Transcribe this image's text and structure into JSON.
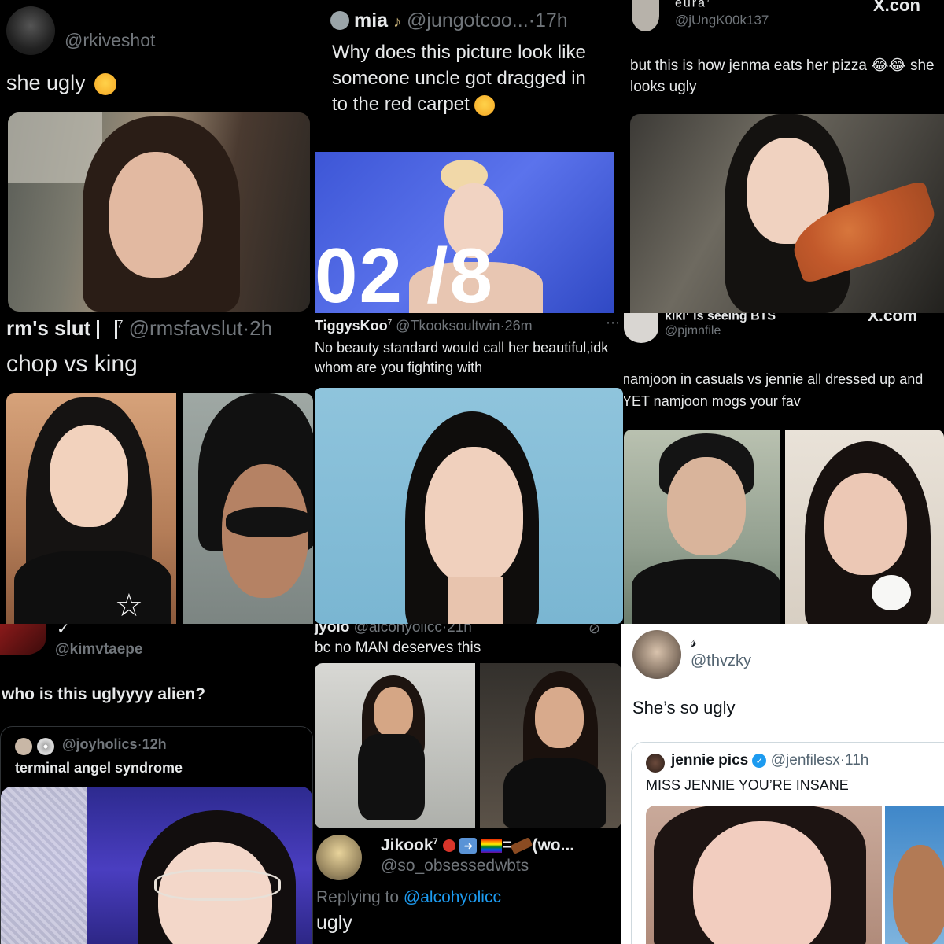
{
  "tiles": [
    {
      "handle": "@rkiveshot",
      "text": "she ugly",
      "emoji": "crying-face"
    },
    {
      "name": "mia",
      "music_note": "♪",
      "handle": "@jungotcoo...",
      "dot": "·",
      "time": "17h",
      "text": "Why does this picture look like someone uncle got dragged in to the red carpet",
      "photo_text": "02 /8"
    },
    {
      "name": "eura",
      "name_sup": "7",
      "handle": "@jUngK00k137",
      "xlogo": "X.con",
      "text": "but this is how jenma eats her pizza 😂😂 she looks ugly"
    },
    {
      "name": "rm's slut",
      "name_sup": "7",
      "handle": "@rmsfavslut",
      "dot": "·",
      "time": "2h",
      "text": "chop vs king"
    },
    {
      "name": "TiggysKoo",
      "name_sup": "7",
      "handle": "@Tkooksoultwin",
      "dot": "·",
      "time": "26m",
      "text": "No beauty standard would call her beautiful,idk whom are you fighting with"
    },
    {
      "name": "kiki",
      "name_sup": "7",
      "name_suffix": "is seeing BTS",
      "handle": "@pjmnfile",
      "xlogo": "X.com",
      "text": "namjoon in casuals vs jennie all dressed up and YET namjoon mogs your fav"
    },
    {
      "check": "✓",
      "handle": "@kimvtaepe",
      "text": "who is this uglyyyy alien?",
      "quote_handle": "@joyholics",
      "quote_dot": "·",
      "quote_time": "12h",
      "quote_text": "terminal angel syndrome"
    },
    {
      "name": "jyolo",
      "handle": "@alcohyolicc",
      "dot": "·",
      "time": "21h",
      "text": "bc no MAN deserves this",
      "reply_name": "Jikook",
      "reply_sup": "7",
      "reply_suffix": "=",
      "reply_more": "(wo...",
      "reply_handle": "@so_obsessedwbts",
      "replying_label": "Replying to",
      "replying_handle": "@alcohyolicc",
      "reply_text": "ugly"
    },
    {
      "name": "𝓈",
      "handle": "@thvzky",
      "text": "She’s so ugly",
      "quote_name": "jennie pics",
      "quote_handle": "@jenfilesx",
      "quote_dot": "·",
      "quote_time": "11h",
      "quote_text": "MISS JENNIE YOU’RE INSANE"
    }
  ],
  "colors": {
    "bg": "#000000",
    "text_dark": "#e7e9ea",
    "handle_gray": "#71767b",
    "link_blue": "#1d9bf0",
    "verified_blue": "#1d9bf0",
    "light_bg": "#ffffff"
  }
}
